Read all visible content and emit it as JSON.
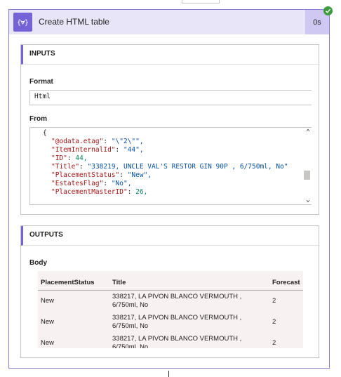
{
  "action": {
    "title": "Create HTML table",
    "duration": "0s",
    "icon": "curly-brace-action-icon",
    "status_icon": "checkmark-icon"
  },
  "inputs": {
    "header": "INPUTS",
    "format_label": "Format",
    "format_value": "Html",
    "from_label": "From",
    "from_lines": [
      {
        "key": "",
        "sep": "",
        "value": "{",
        "vclass": "p"
      },
      {
        "key": "\"@odata.etag\"",
        "sep": ": ",
        "value": "\"\\\"2\\\"\",",
        "vclass": "s"
      },
      {
        "key": "\"ItemInternalId\"",
        "sep": ": ",
        "value": "\"44\",",
        "vclass": "s"
      },
      {
        "key": "\"ID\"",
        "sep": ": ",
        "value": "44,",
        "vclass": "n"
      },
      {
        "key": "\"Title\"",
        "sep": ": ",
        "value": "\"338219, UNCLE VAL'S RESTOR GIN 90P , 6/750ml, No\"",
        "vclass": "s"
      },
      {
        "key": "\"PlacementStatus\"",
        "sep": ": ",
        "value": "\"New\",",
        "vclass": "s"
      },
      {
        "key": "\"EstatesFlag\"",
        "sep": ": ",
        "value": "\"No\",",
        "vclass": "s"
      },
      {
        "key": "\"PlacementMasterID\"",
        "sep": ": ",
        "value": "26,",
        "vclass": "n"
      }
    ]
  },
  "outputs": {
    "header": "OUTPUTS",
    "body_label": "Body",
    "columns": [
      "PlacementStatus",
      "Title",
      "Forecast"
    ],
    "rows": [
      [
        "New",
        "338217, LA PIVON BLANCO VERMOUTH , 6/750ml, No",
        "2"
      ],
      [
        "New",
        "338217, LA PIVON BLANCO VERMOUTH , 6/750ml, No",
        "2"
      ],
      [
        "New",
        "338217, LA PIVON BLANCO VERMOUTH , 6/750ml, No",
        "2"
      ]
    ]
  },
  "colors": {
    "accent": "#7562d6",
    "header_bg": "#e8e5f9",
    "success": "#3c9b3c"
  }
}
